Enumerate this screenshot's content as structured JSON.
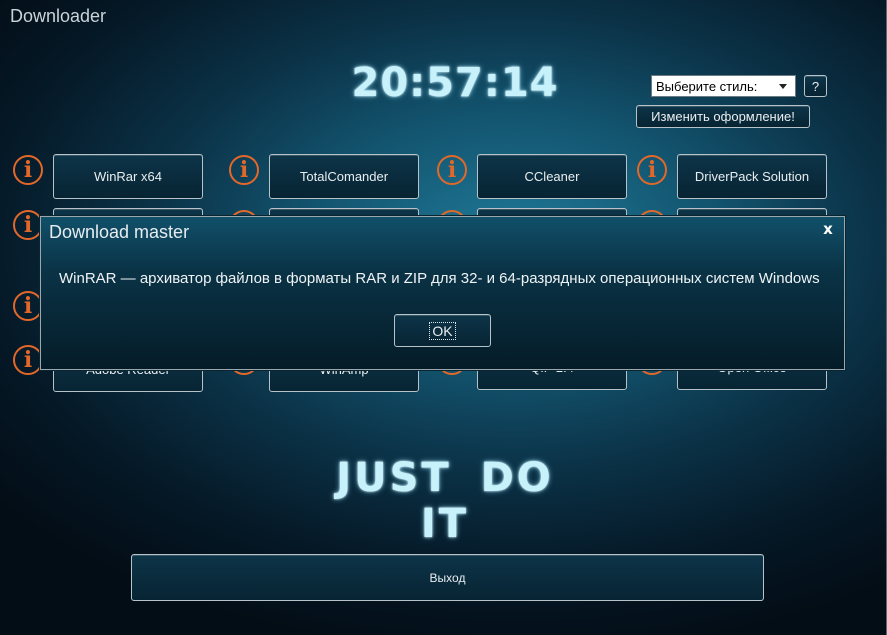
{
  "window": {
    "title": "Downloader"
  },
  "clock": "20:57:14",
  "style_selector": {
    "selected": "Выберите стиль:"
  },
  "help_button": "?",
  "change_button": "Изменить оформление!",
  "apps": [
    {
      "label": "WinRar x64"
    },
    {
      "label": "TotalComander"
    },
    {
      "label": "CCleaner"
    },
    {
      "label": "DriverPack Solution"
    },
    {
      "label": ""
    },
    {
      "label": ""
    },
    {
      "label": ""
    },
    {
      "label": ""
    },
    {
      "label": ""
    },
    {
      "label": ""
    },
    {
      "label": ""
    },
    {
      "label": ""
    },
    {
      "label": "Adobe Reader"
    },
    {
      "label": "WinAmp"
    },
    {
      "label": "QIP 2.4"
    },
    {
      "label": "Open Office"
    }
  ],
  "info_icon_glyph": "i",
  "slogan": "JUST DO IT",
  "exit_button": "Выход",
  "dialog": {
    "title": "Download master",
    "close": "x",
    "message": "WinRAR — архиватор файлов в форматы RAR и ZIP для 32- и 64-разрядных операционных систем Windows",
    "ok": "OK"
  },
  "colors": {
    "accent_orange": "#e2682a",
    "glow_text": "#c8f2fb",
    "button_border": "#b7c3c8"
  }
}
